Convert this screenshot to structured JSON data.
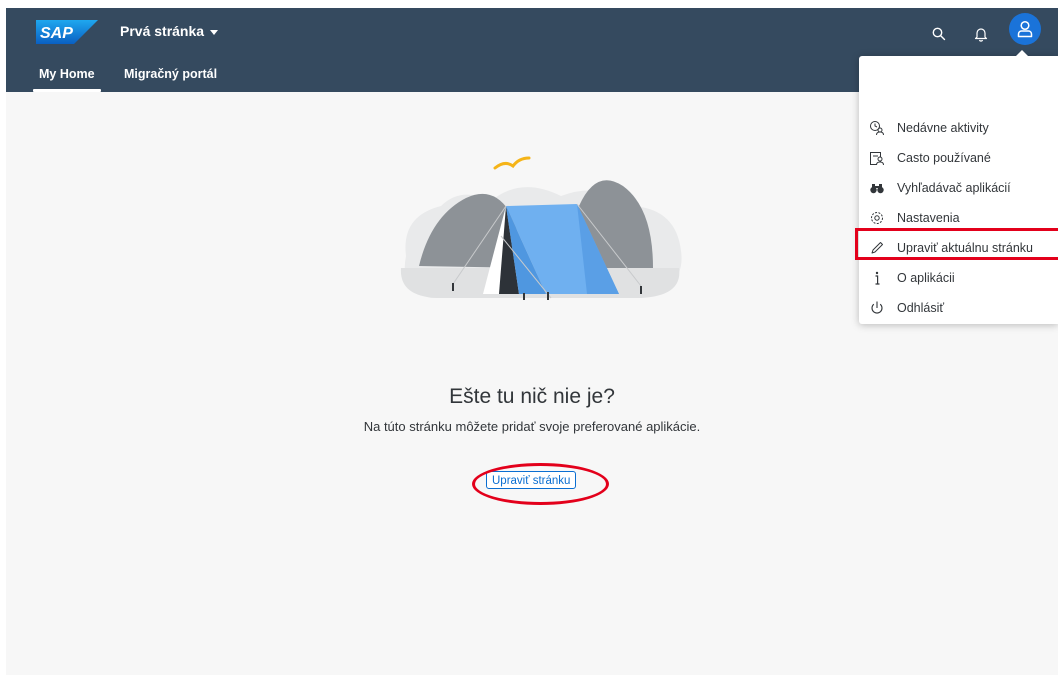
{
  "header": {
    "logo_text": "SAP",
    "page_title": "Prvá stránka",
    "brand_color": "#354a5f",
    "accent_color": "#0a6ed1",
    "icons": [
      "search-icon",
      "bell-icon",
      "user-icon"
    ]
  },
  "nav": {
    "tabs": [
      {
        "label": "My Home",
        "active": true
      },
      {
        "label": "Migračný portál",
        "active": false
      }
    ]
  },
  "empty_state": {
    "title": "Ešte tu nič nie je?",
    "description": "Na túto stránku môžete pridať svoje preferované aplikácie.",
    "button_label": "Upraviť stránku"
  },
  "user_menu": {
    "items": [
      {
        "label": "Nedávne aktivity",
        "icon": "recent-activity-icon"
      },
      {
        "label": "Casto používané",
        "icon": "frequently-used-icon"
      },
      {
        "label": "Vyhľadávač aplikácií",
        "icon": "binoculars-icon"
      },
      {
        "label": "Nastavenia",
        "icon": "gear-icon"
      },
      {
        "label": "Upraviť aktuálnu stránku",
        "icon": "pencil-icon"
      },
      {
        "label": "O aplikácii",
        "icon": "info-icon"
      },
      {
        "label": "Odhlásiť",
        "icon": "power-icon"
      }
    ]
  },
  "annotations": {
    "highlight_color": "#e3001b"
  }
}
